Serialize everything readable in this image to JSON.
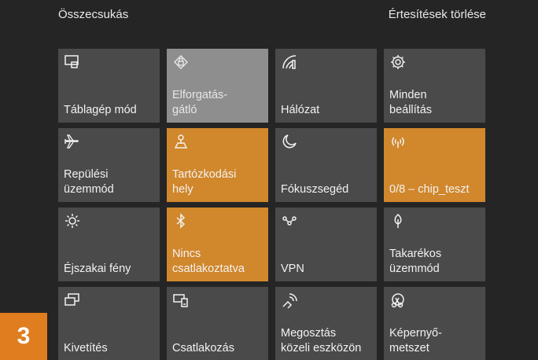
{
  "header": {
    "collapse_label": "Összecsukás",
    "clear_label": "Értesítések törlése"
  },
  "tiles": [
    {
      "label": "Táblagép mód",
      "icon": "tablet-mode-icon",
      "state": "off"
    },
    {
      "label": "Elforgatás-\ngátló",
      "icon": "rotation-lock-icon",
      "state": "disabled"
    },
    {
      "label": "Hálózat",
      "icon": "network-icon",
      "state": "off"
    },
    {
      "label": "Minden\nbeállítás",
      "icon": "settings-gear-icon",
      "state": "off"
    },
    {
      "label": "Repülési\nüzemmód",
      "icon": "airplane-icon",
      "state": "off"
    },
    {
      "label": "Tartózkodási\nhely",
      "icon": "location-icon",
      "state": "on"
    },
    {
      "label": "Fókuszsegéd",
      "icon": "moon-icon",
      "state": "off"
    },
    {
      "label": "0/8 – chip_teszt",
      "icon": "mobile-hotspot-icon",
      "state": "on"
    },
    {
      "label": "Éjszakai fény",
      "icon": "brightness-sun-icon",
      "state": "off"
    },
    {
      "label": "Nincs\ncsatlakoztatva",
      "icon": "bluetooth-icon",
      "state": "on"
    },
    {
      "label": "VPN",
      "icon": "vpn-icon",
      "state": "off"
    },
    {
      "label": "Takarékos\nüzemmód",
      "icon": "battery-saver-leaf-icon",
      "state": "off"
    },
    {
      "label": "Kivetítés",
      "icon": "project-screens-icon",
      "state": "off"
    },
    {
      "label": "Csatlakozás",
      "icon": "connect-devices-icon",
      "state": "off"
    },
    {
      "label": "Megosztás\nközeli eszközön",
      "icon": "nearby-share-icon",
      "state": "off"
    },
    {
      "label": "Képernyő-\nmetszet",
      "icon": "screen-snip-icon",
      "state": "off"
    }
  ],
  "badge": {
    "number": "3"
  },
  "colors": {
    "panel_bg": "#252525",
    "tile_off": "#4a4a4a",
    "tile_on": "#d1872c",
    "tile_disabled": "#8e8e8e",
    "badge": "#e07d1e"
  }
}
